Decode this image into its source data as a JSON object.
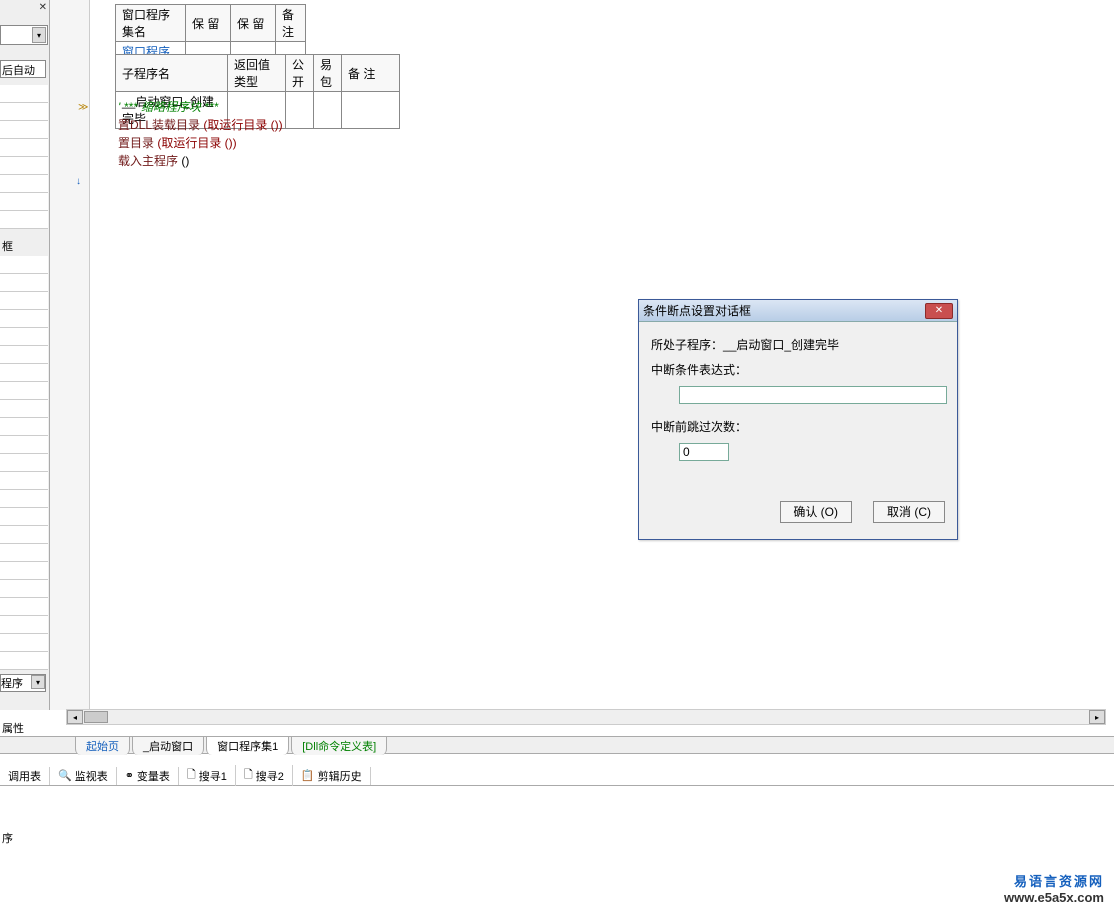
{
  "left": {
    "auto_text": "后自动",
    "box_text": "框",
    "prog_text": "程序",
    "prop_text": "属性"
  },
  "table1": {
    "h1": "窗口程序集名",
    "h2": "保  留",
    "h3": "保  留",
    "h4": "备 注",
    "r1c1": "窗口程序集1"
  },
  "table2": {
    "h1": "子程序名",
    "h2": "返回值类型",
    "h3": "公 开",
    "h4": "易包",
    "h5": "备  注",
    "r1c1": "__启动窗口_创建完毕"
  },
  "code": {
    "l1": "' *** 缩略程序块 ***",
    "l2a": "置DLL装载目录",
    "l2b": " (取运行目录 ())",
    "l3a": "置目录",
    "l3b": " (取运行目录 ())",
    "l4a": "载入主程序",
    "l4b": " ()"
  },
  "tabs": {
    "t1": "起始页",
    "t2": "_启动窗口",
    "t3": "窗口程序集1",
    "t4": "[Dll命令定义表]"
  },
  "tools": {
    "t1": "调用表",
    "t2": "监视表",
    "t3": "变量表",
    "t4": "搜寻1",
    "t5": "搜寻2",
    "t6": "剪辑历史"
  },
  "status": "序",
  "dialog": {
    "title": "条件断点设置对话框",
    "sub_label": "所处子程序：",
    "sub_value": "__启动窗口_创建完毕",
    "cond_label": "中断条件表达式：",
    "cond_value": "",
    "skip_label": "中断前跳过次数：",
    "skip_value": "0",
    "ok": "确认 (O)",
    "cancel": "取消 (C)"
  },
  "watermark": {
    "cn": "易语言资源网",
    "url": "www.e5a5x.com"
  }
}
